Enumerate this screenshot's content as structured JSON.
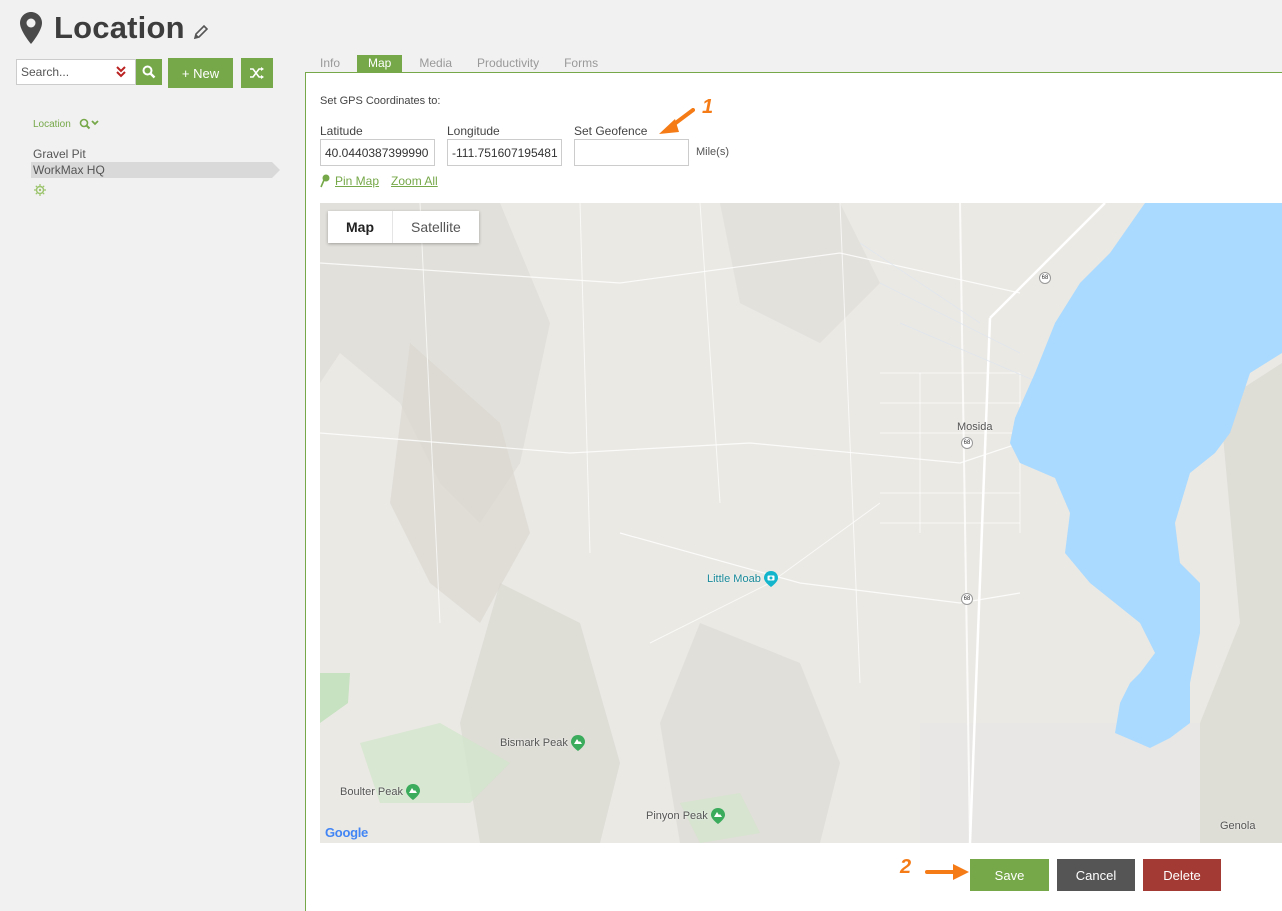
{
  "header": {
    "title": "Location"
  },
  "sidebar": {
    "search_placeholder": "Search...",
    "new_label": "+ New",
    "tree_header": "Location",
    "items": [
      {
        "label": "Gravel Pit",
        "selected": false
      },
      {
        "label": "WorkMax HQ",
        "selected": true
      }
    ]
  },
  "tabs": [
    {
      "label": "Info",
      "active": false
    },
    {
      "label": "Map",
      "active": true
    },
    {
      "label": "Media",
      "active": false
    },
    {
      "label": "Productivity",
      "active": false
    },
    {
      "label": "Forms",
      "active": false
    }
  ],
  "form": {
    "gps_label": "Set GPS Coordinates to:",
    "latitude_label": "Latitude",
    "latitude_value": "40.0440387399990",
    "longitude_label": "Longitude",
    "longitude_value": "-111.751607195481",
    "geofence_label": "Set Geofence",
    "geofence_value": "",
    "geofence_unit": "Mile(s)",
    "pin_map_label": "Pin Map",
    "zoom_all_label": "Zoom All"
  },
  "map": {
    "type_buttons": [
      "Map",
      "Satellite"
    ],
    "active_type": "Map",
    "places": {
      "mosida": "Mosida",
      "little_moab": "Little Moab",
      "bismark": "Bismark Peak",
      "boulter": "Boulter Peak",
      "pinyon": "Pinyon Peak",
      "genola": "Genola"
    },
    "highway": "68",
    "attribution": "Google",
    "lake_color": "#aadaff",
    "land_color": "#ebe9e4"
  },
  "annotations": {
    "marker1": "1",
    "marker2": "2",
    "color": "#f47b16"
  },
  "actions": {
    "save": "Save",
    "cancel": "Cancel",
    "delete": "Delete"
  },
  "colors": {
    "accent": "#76a849",
    "cancel": "#555555",
    "delete": "#a33a33"
  }
}
